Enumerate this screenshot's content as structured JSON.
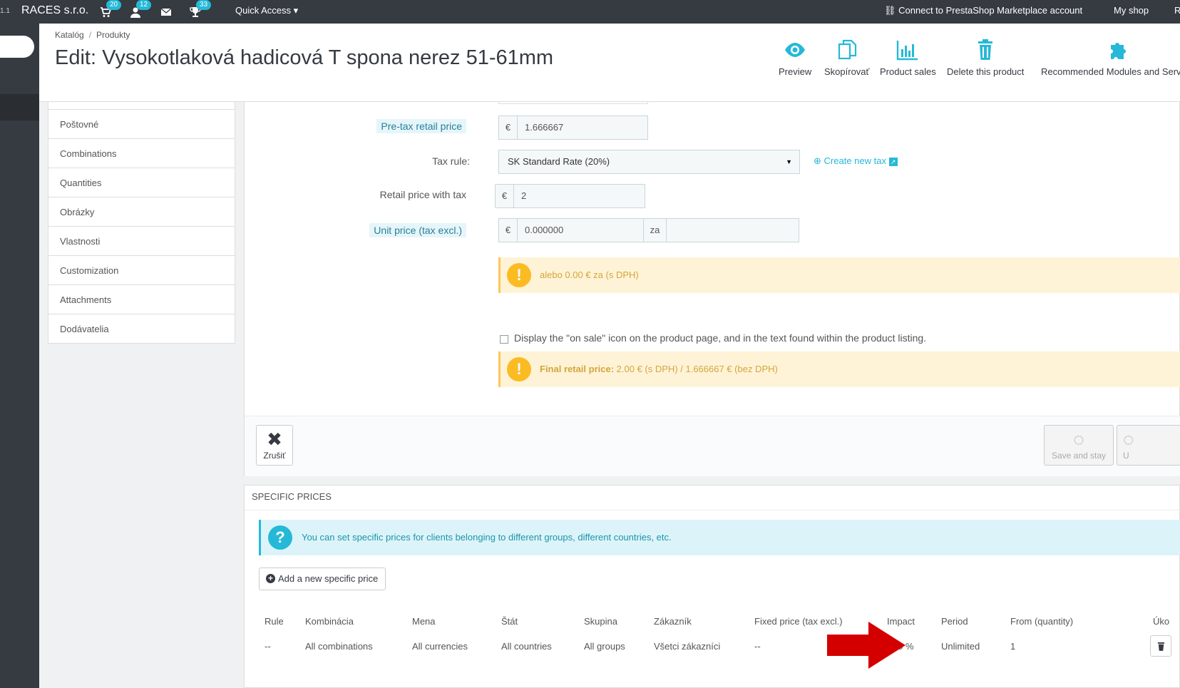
{
  "topbar": {
    "version_fragment": "1.1",
    "shop_name": "RACES s.r.o.",
    "badges": {
      "orders": "20",
      "customers": "12",
      "trophies": "33"
    },
    "quick_access": "Quick Access",
    "connect": "Connect to PrestaShop Marketplace account",
    "my_shop": "My shop",
    "cut": "R"
  },
  "header": {
    "breadcrumb": [
      "Katalóg",
      "Produkty"
    ],
    "title": "Edit: Vysokotlaková hadicová T spona nerez 51-61mm",
    "toolbar": [
      {
        "label": "Preview",
        "icon": "eye-icon"
      },
      {
        "label": "Skopírovať",
        "icon": "copy-icon"
      },
      {
        "label": "Product sales",
        "icon": "bar-chart-icon"
      },
      {
        "label": "Delete this product",
        "icon": "trash-icon"
      },
      {
        "label": "Recommended Modules and Services",
        "icon": "puzzle-icon"
      }
    ]
  },
  "tabs": [
    "Poštovné",
    "Combinations",
    "Quantities",
    "Obrázky",
    "Vlastnosti",
    "Customization",
    "Attachments",
    "Dodávatelia"
  ],
  "prices": {
    "pretax_label": "Pre-tax retail price",
    "currency": "€",
    "pretax_value": "1.666667",
    "tax_rule_label": "Tax rule:",
    "tax_rule_value": "SK Standard Rate (20%)",
    "create_tax": "Create new tax",
    "with_tax_label": "Retail price with tax",
    "with_tax_value": "2",
    "unit_label": "Unit price (tax excl.)",
    "unit_value": "0.000000",
    "unit_za": "za",
    "unit_alert": "alebo 0.00 € za (s DPH)",
    "on_sale_label": "Display the \"on sale\" icon on the product page, and in the text found within the product listing.",
    "final_label": "Final retail price:",
    "final_value": "2.00 € (s DPH) / 1.666667 € (bez DPH)",
    "cancel": "Zrušiť",
    "save_stay": "Save and stay",
    "save_cut": "U"
  },
  "specific_prices": {
    "title": "SPECIFIC PRICES",
    "info": "You can set specific prices for clients belonging to different groups, different countries, etc.",
    "add_button": "Add a new specific price",
    "columns": [
      "Rule",
      "Kombinácia",
      "Mena",
      "Štát",
      "Skupina",
      "Zákazník",
      "Fixed price (tax excl.)",
      "Impact",
      "Period",
      "From (quantity)",
      "Úko"
    ],
    "row": [
      "--",
      "All combinations",
      "All currencies",
      "All countries",
      "All groups",
      "Všetci zákazníci",
      "--",
      "- 20 %",
      "Unlimited",
      "1"
    ]
  },
  "colors": {
    "accent": "#25b9d7",
    "warning": "#fbbb22",
    "annotation_arrow": "#d40000"
  }
}
